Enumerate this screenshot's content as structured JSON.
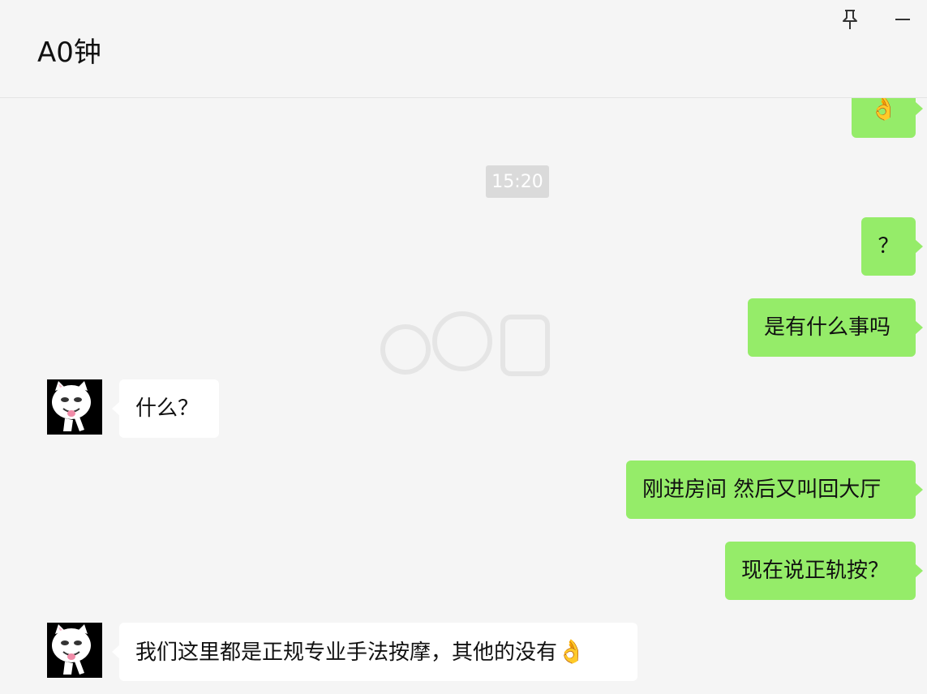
{
  "header": {
    "title": "A0钟",
    "pin_icon": "pin-icon",
    "minimize_icon": "minimize-icon"
  },
  "messages": {
    "ok_sticker": "👌",
    "time": "15:20",
    "m1": "？",
    "m2": "是有什么事吗",
    "m3": "什么？",
    "m4": "刚进房间 然后又叫回大厅",
    "m5": "现在说正轨按？",
    "m6": "我们这里都是正规专业手法按摩，其他的没有",
    "m6_emoji": "👌"
  },
  "colors": {
    "my_bubble": "#95ec69",
    "their_bubble": "#ffffff",
    "background": "#f5f5f5"
  }
}
